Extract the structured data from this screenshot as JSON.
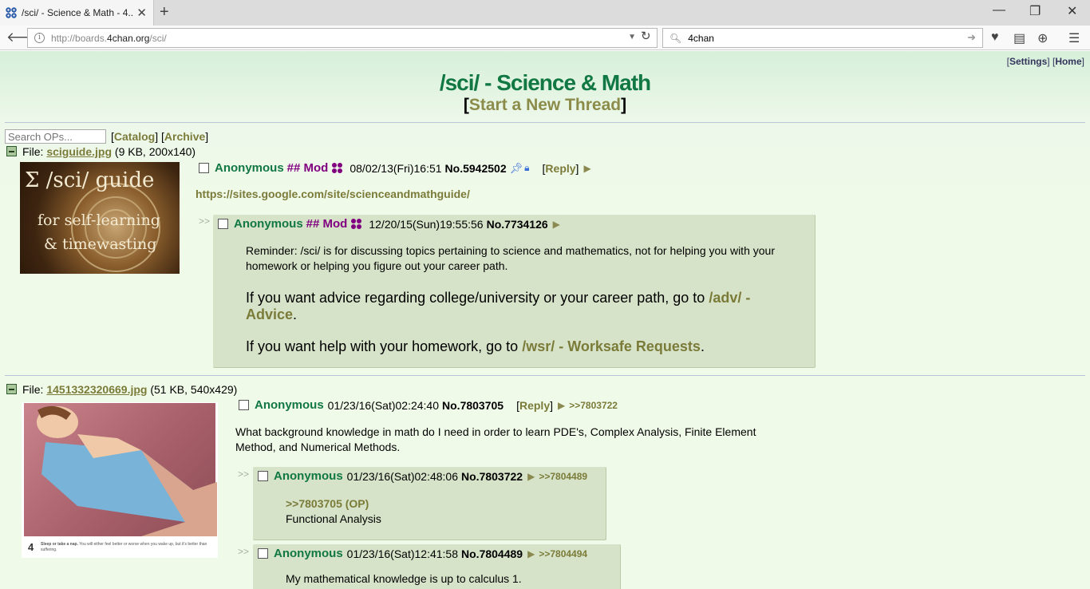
{
  "browser": {
    "tab_title": "/sci/ - Science & Math - 4...",
    "new_tab": "+",
    "url_domain_prefix": "http://boards.",
    "url_domain": "4chan.org",
    "url_path": "/sci/",
    "search_value": "4chan",
    "win_min": "—",
    "win_restore": "❐",
    "win_close": "✕"
  },
  "toplinks": {
    "settings": "Settings",
    "home": "Home"
  },
  "board": {
    "title": "/sci/ - Science & Math",
    "new_thread_open": "[",
    "new_thread": "Start a New Thread",
    "new_thread_close": "]"
  },
  "toolbar": {
    "search_placeholder": "Search OPs...",
    "catalog": "Catalog",
    "archive": "Archive"
  },
  "thread1": {
    "file_label": "File: ",
    "file_name": "sciguide.jpg",
    "file_meta": "(9 KB, 200x140)",
    "thumb_text_1": "Σ /sci/ guide",
    "thumb_text_2": "for self-learning",
    "thumb_text_3": "& timewasting",
    "op": {
      "name": "Anonymous",
      "capcode": "## Mod",
      "datetime": "08/02/13(Fri)16:51",
      "no_label": "No.",
      "no": "5942502",
      "reply_open": "[",
      "reply": "Reply",
      "reply_close": "]",
      "link": "https://sites.google.com/site/scienceandmathguide/"
    },
    "reply": {
      "name": "Anonymous",
      "capcode": "## Mod",
      "datetime": "12/20/15(Sun)19:55:56",
      "no_label": "No.",
      "no": "7734126",
      "para1": "Reminder: /sci/ is for discussing topics pertaining to science and mathematics, not for helping you with your homework or helping you figure out your career path.",
      "para2_pre": "If you want advice regarding college/university or your career path, go to ",
      "para2_link": "/adv/ - Advice",
      "para2_post": ".",
      "para3_pre": "If you want help with your homework, go to ",
      "para3_link": "/wsr/ - Worksafe Requests",
      "para3_post": "."
    }
  },
  "thread2": {
    "file_label": "File: ",
    "file_name": "1451332320669.jpg",
    "file_meta": "(51 KB, 540x429)",
    "thumb_caption_num": "4",
    "thumb_caption_bold": "Sleep or take a nap.",
    "thumb_caption_rest": "You will either feel better or worse when you wake up, but it's better than suffering.",
    "op": {
      "name": "Anonymous",
      "datetime": "01/23/16(Sat)02:24:40",
      "no_label": "No.",
      "no": "7803705",
      "reply_open": "[",
      "reply": "Reply",
      "reply_close": "]",
      "backlink": ">>7803722",
      "text": "What background knowledge in math do I need in order to learn PDE's, Complex Analysis, Finite Element Method, and Numerical Methods."
    },
    "replies": [
      {
        "name": "Anonymous",
        "datetime": "01/23/16(Sat)02:48:06",
        "no_label": "No.",
        "no": "7803722",
        "backlink": ">>7804489",
        "quote": ">>7803705 (OP)",
        "text": "Functional Analysis"
      },
      {
        "name": "Anonymous",
        "datetime": "01/23/16(Sat)12:41:58",
        "no_label": "No.",
        "no": "7804489",
        "backlink": ">>7804494",
        "text": "My mathematical knowledge is up to calculus 1."
      }
    ]
  },
  "doubledash": ">>"
}
